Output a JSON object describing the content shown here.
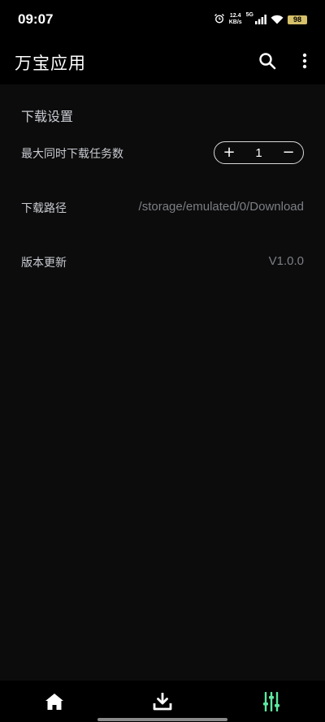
{
  "status_bar": {
    "time": "09:07",
    "net_speed_value": "12.4",
    "net_speed_unit": "KB/s",
    "signal_type": "5G",
    "battery": "98",
    "icons": [
      "alarm-icon",
      "signal-icon",
      "wifi-icon",
      "battery-icon"
    ]
  },
  "app_bar": {
    "title": "万宝应用",
    "actions": [
      "search-icon",
      "more-vert-icon"
    ]
  },
  "settings": {
    "section_title": "下载设置",
    "max_tasks": {
      "label": "最大同时下载任务数",
      "plus": "+",
      "value": "1",
      "minus": "−"
    },
    "download_path": {
      "label": "下载路径",
      "value": "/storage/emulated/0/Download"
    },
    "version": {
      "label": "版本更新",
      "value": "V1.0.0"
    }
  },
  "bottom_nav": {
    "items": [
      {
        "icon": "home-icon",
        "active": false
      },
      {
        "icon": "download-icon",
        "active": false
      },
      {
        "icon": "settings-sliders-icon",
        "active": true
      }
    ]
  },
  "colors": {
    "background": "#0c0c0c",
    "bar_background": "#000000",
    "accent_active": "#5ee8a0",
    "label_text": "#c9ccd2",
    "value_text": "#7c7f85"
  }
}
